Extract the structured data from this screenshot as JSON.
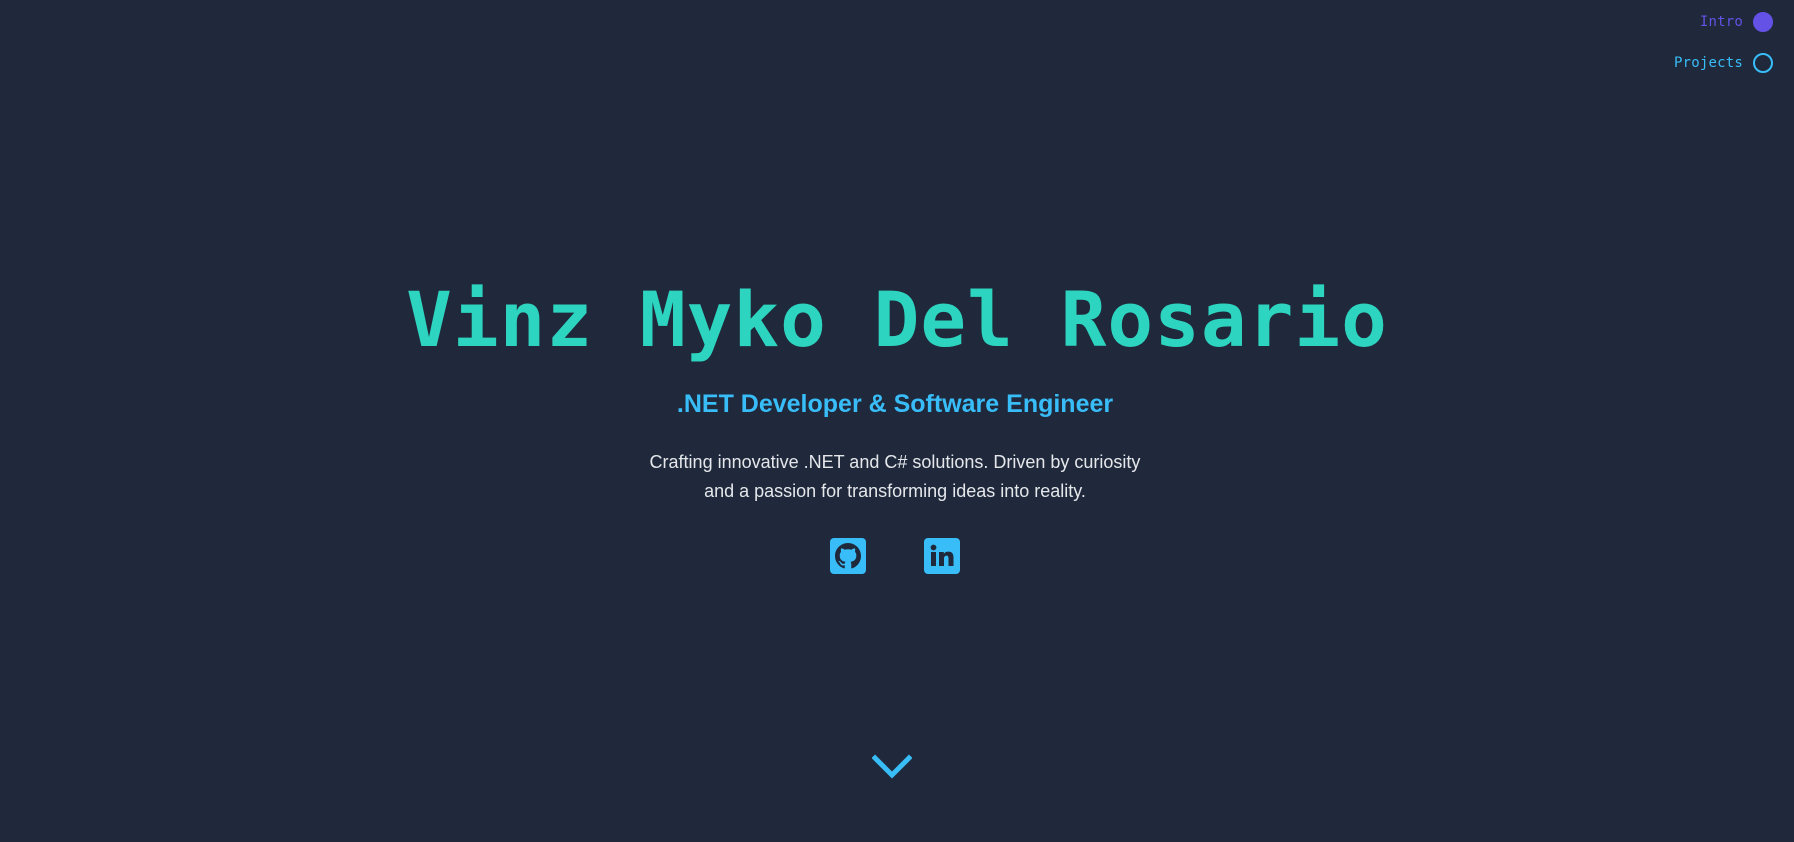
{
  "nav": {
    "items": [
      {
        "label": "Intro",
        "state": "active"
      },
      {
        "label": "Projects",
        "state": "inactive"
      }
    ]
  },
  "hero": {
    "name": "Vinz Myko Del Rosario",
    "role": ".NET Developer & Software Engineer",
    "description_line1": "Crafting innovative .NET and C# solutions. Driven by curiosity",
    "description_line2": "and a passion for transforming ideas into reality."
  },
  "socials": [
    {
      "icon": "github-icon"
    },
    {
      "icon": "linkedin-icon"
    }
  ],
  "scroll": {
    "icon": "chevron-down-icon"
  },
  "colors": {
    "background": "#1f293b",
    "name": "#2dd4bf",
    "accent": "#38bdf8",
    "active_nav": "#6451e6",
    "body_text": "#e5e7eb"
  }
}
